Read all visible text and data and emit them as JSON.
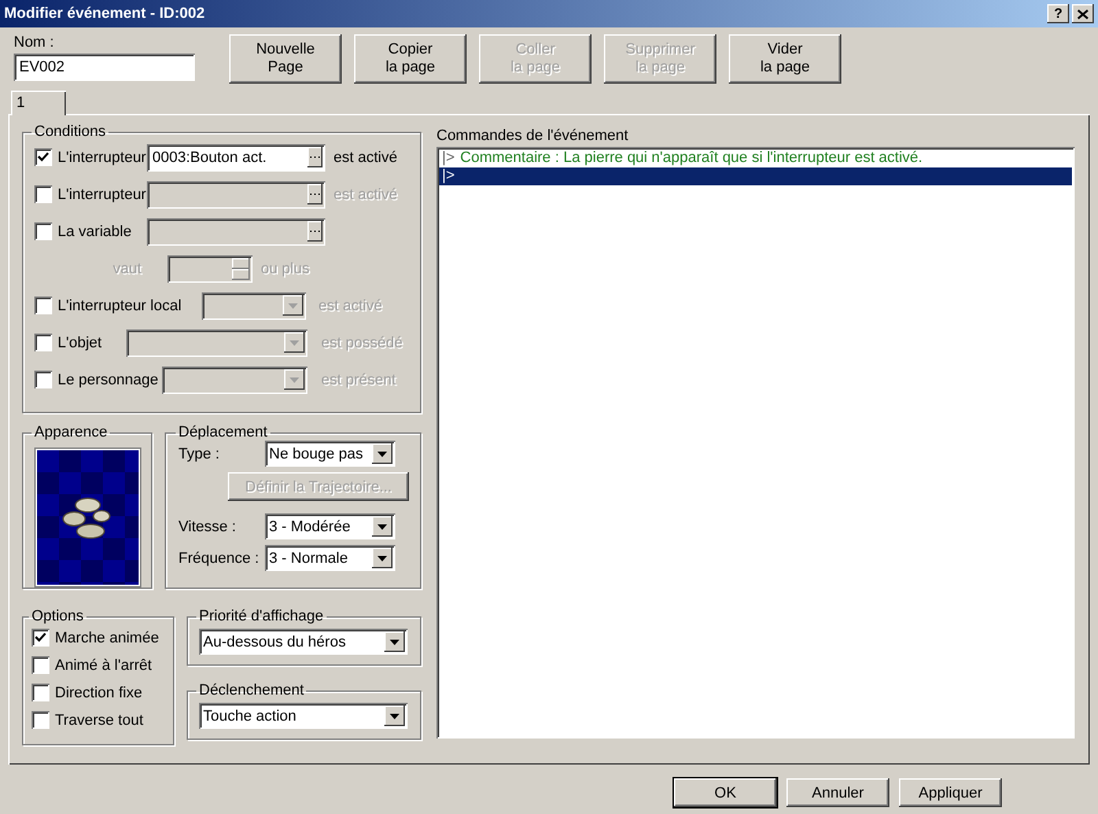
{
  "window": {
    "title": "Modifier événement - ID:002",
    "help": "?"
  },
  "name": {
    "label": "Nom :",
    "value": "EV002"
  },
  "page_buttons": [
    {
      "label": "Nouvelle\nPage",
      "disabled": false
    },
    {
      "label": "Copier\nla page",
      "disabled": false
    },
    {
      "label": "Coller\nla page",
      "disabled": true
    },
    {
      "label": "Supprimer\nla page",
      "disabled": true
    },
    {
      "label": "Vider\nla page",
      "disabled": false
    }
  ],
  "tabs": [
    {
      "label": "1",
      "selected": true
    }
  ],
  "conditions": {
    "title": "Conditions",
    "rows": [
      {
        "kind": "browse",
        "checked": true,
        "enabled": true,
        "label": "L'interrupteur",
        "value": "0003:Bouton act.",
        "suffix": "est activé"
      },
      {
        "kind": "browse",
        "checked": false,
        "enabled": false,
        "label": "L'interrupteur",
        "suffix": "est activé"
      },
      {
        "kind": "browse",
        "checked": false,
        "enabled": false,
        "label": "La variable"
      },
      {
        "kind": "spin",
        "enabled": false,
        "label": "vaut",
        "suffix": "ou plus"
      },
      {
        "kind": "local",
        "checked": false,
        "enabled": false,
        "label": "L'interrupteur local",
        "suffix": "est activé"
      },
      {
        "kind": "item",
        "checked": false,
        "enabled": false,
        "label": "L'objet",
        "suffix": "est possédé"
      },
      {
        "kind": "actor",
        "checked": false,
        "enabled": false,
        "label": "Le personnage",
        "suffix": "est présent"
      }
    ]
  },
  "appearance": {
    "title": "Apparence"
  },
  "movement": {
    "title": "Déplacement",
    "type_label": "Type :",
    "type_value": "Ne bouge pas",
    "route_button": {
      "label": "Définir la Trajectoire...",
      "disabled": true
    },
    "speed_label": "Vitesse :",
    "speed_value": "3 - Modérée",
    "frequency_label": "Fréquence :",
    "frequency_value": "3 - Normale"
  },
  "options": {
    "title": "Options",
    "items": [
      {
        "label": "Marche animée",
        "checked": true
      },
      {
        "label": "Animé à l'arrêt",
        "checked": false
      },
      {
        "label": "Direction fixe",
        "checked": false
      },
      {
        "label": "Traverse tout",
        "checked": false
      }
    ]
  },
  "priority": {
    "title": "Priorité d'affichage",
    "value": "Au-dessous du héros"
  },
  "trigger": {
    "title": "Déclenchement",
    "value": "Touche action"
  },
  "commands": {
    "title": "Commandes de l'événement",
    "items": [
      {
        "kind": "comment",
        "marker": "|>",
        "text": "Commentaire : La pierre qui n'apparaît que si l'interrupteur est activé.",
        "selected": false
      },
      {
        "kind": "empty",
        "marker": "|>",
        "selected": true
      }
    ]
  },
  "footer_buttons": [
    {
      "label": "OK",
      "default": true
    },
    {
      "label": "Annuler",
      "default": false
    },
    {
      "label": "Appliquer",
      "default": false
    }
  ]
}
